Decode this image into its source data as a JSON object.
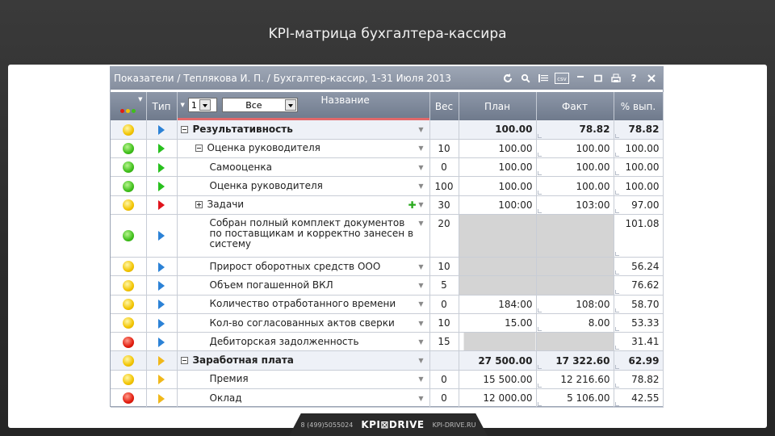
{
  "slide": {
    "title": "KPI-матрица бухгалтера-кассира"
  },
  "window": {
    "title": "Показатели / Теплякова И. П. / Бухгалтер-кассир, 1-31 Июля 2013"
  },
  "toolbar": {
    "icons": [
      "refresh-icon",
      "search-icon",
      "list-icon",
      "csv-icon",
      "minimize-icon",
      "maximize-icon",
      "print-icon",
      "help-icon",
      "close-icon"
    ],
    "csv_label": "csv",
    "help_label": "?"
  },
  "header": {
    "type": "Тип",
    "level_value": "1",
    "filter_value": "Все",
    "name": "Название",
    "weight": "Вес",
    "plan": "План",
    "fact": "Факт",
    "percent": "% вып."
  },
  "colors": {
    "yellow": "#f2c400",
    "green": "#3fbf1a",
    "red": "#e21c0e",
    "header": "#7f8a9b"
  },
  "rows": [
    {
      "status": "yellow",
      "type": "blue",
      "indent": 0,
      "expander": "minus",
      "name": "Результативность",
      "group": true,
      "weight": "",
      "plan": "100.00",
      "fact": "78.82",
      "percent": "78.82"
    },
    {
      "status": "green",
      "type": "green",
      "indent": 1,
      "expander": "minus",
      "name": "Оценка руководителя",
      "weight": "10",
      "plan": "100.00",
      "fact": "100.00",
      "percent": "100.00"
    },
    {
      "status": "green",
      "type": "green",
      "indent": 2,
      "name": "Самооценка",
      "weight": "0",
      "plan": "100.00",
      "fact": "100.00",
      "percent": "100.00"
    },
    {
      "status": "green",
      "type": "green",
      "indent": 2,
      "name": "Оценка руководителя",
      "weight": "100",
      "plan": "100.00",
      "fact": "100.00",
      "percent": "100.00"
    },
    {
      "status": "yellow",
      "type": "red",
      "indent": 1,
      "expander": "plus",
      "name": "Задачи",
      "add_icon": true,
      "weight": "30",
      "plan": "100:00",
      "fact": "103:00",
      "percent": "97.00"
    },
    {
      "status": "green",
      "type": "blue",
      "indent": 2,
      "name": "Собран полный комплект документов по поставщикам и корректно занесен в систему",
      "tall": true,
      "weight": "20",
      "plan": "",
      "fact": "",
      "percent": "101.08",
      "grey": true
    },
    {
      "status": "yellow",
      "type": "blue",
      "indent": 2,
      "name": "Прирост оборотных средств ООО",
      "weight": "10",
      "plan": "",
      "fact": "",
      "percent": "56.24",
      "grey": true
    },
    {
      "status": "yellow",
      "type": "blue",
      "indent": 2,
      "name": "Объем погашенной ВКЛ",
      "weight": "5",
      "plan": "",
      "fact": "",
      "percent": "76.62",
      "grey": true
    },
    {
      "status": "yellow",
      "type": "blue",
      "indent": 2,
      "name": "Количество отработанного времени",
      "weight": "0",
      "plan": "184:00",
      "fact": "108:00",
      "percent": "58.70"
    },
    {
      "status": "yellow",
      "type": "blue",
      "indent": 2,
      "name": "Кол-во согласованных актов сверки",
      "weight": "10",
      "plan": "15.00",
      "fact": "8.00",
      "percent": "53.33"
    },
    {
      "status": "red",
      "type": "blue",
      "indent": 2,
      "name": "Дебиторская задолженность",
      "weight": "15",
      "plan": "",
      "fact": "",
      "percent": "31.41",
      "grey": true,
      "grey_left": true
    },
    {
      "status": "yellow",
      "type": "gold",
      "indent": 0,
      "expander": "minus",
      "name": "Заработная плата",
      "group": true,
      "weight": "",
      "plan": "27 500.00",
      "fact": "17 322.60",
      "percent": "62.99"
    },
    {
      "status": "yellow",
      "type": "gold",
      "indent": 2,
      "name": "Премия",
      "weight": "0",
      "plan": "15 500.00",
      "fact": "12 216.60",
      "percent": "78.82"
    },
    {
      "status": "red",
      "type": "gold",
      "indent": 2,
      "name": "Оклад",
      "weight": "0",
      "plan": "12 000.00",
      "fact": "5 106.00",
      "percent": "42.55"
    }
  ],
  "footer": {
    "phone": "8 (499)5055024",
    "logo": "KPI⊠DRIVE",
    "site": "KPI-DRIVE.RU"
  }
}
